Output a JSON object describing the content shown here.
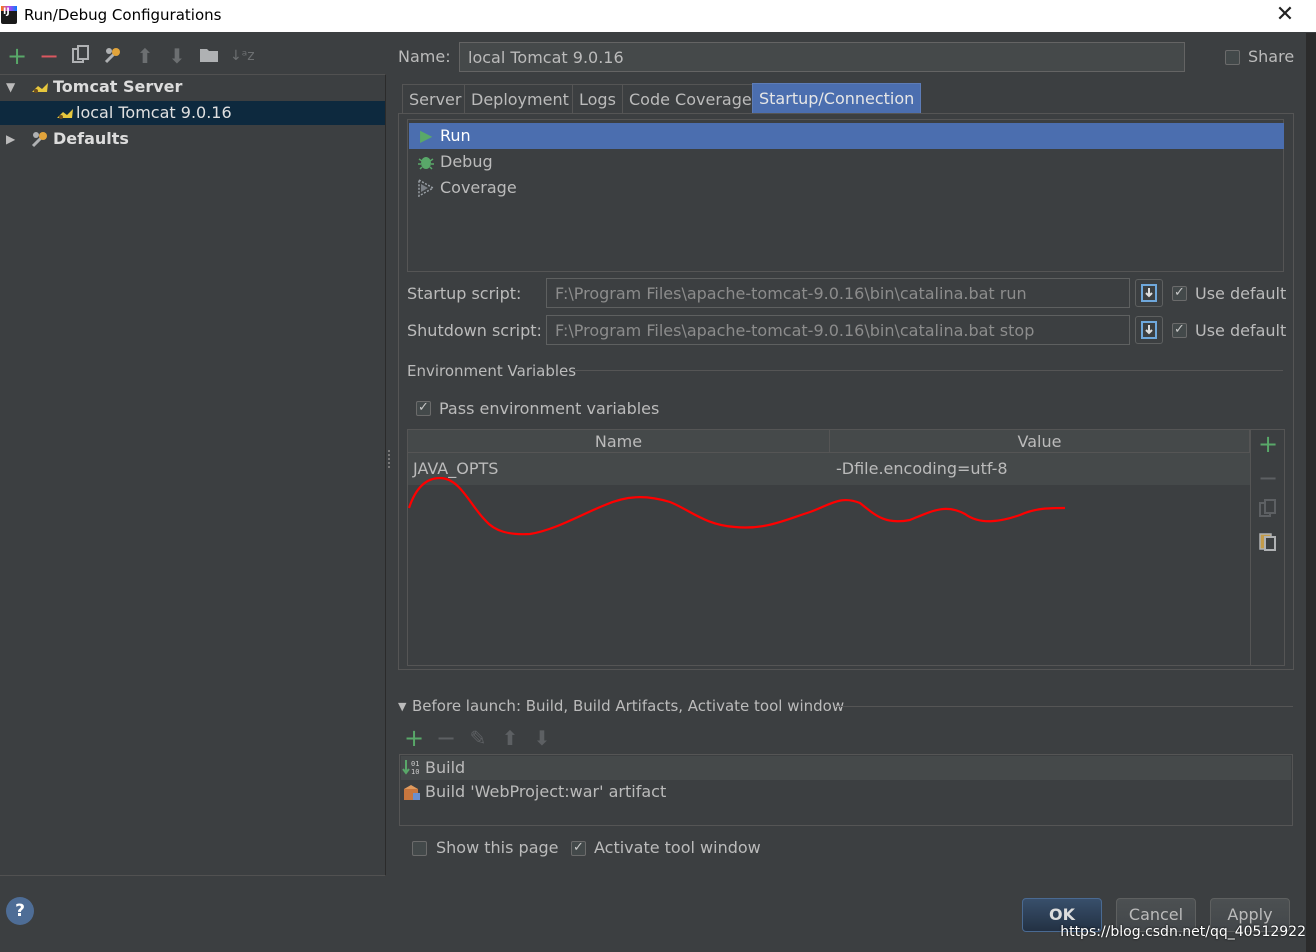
{
  "window": {
    "title": "Run/Debug Configurations"
  },
  "left_toolbar": {
    "icons": [
      "add-icon",
      "remove-icon",
      "copy-icon",
      "wrench-icon",
      "arrow-up-icon",
      "arrow-down-icon",
      "folder-icon",
      "sort-icon"
    ]
  },
  "tree": {
    "group": "Tomcat Server",
    "child": "local Tomcat 9.0.16",
    "defaults": "Defaults"
  },
  "config": {
    "name_label": "Name:",
    "name_value": "local Tomcat 9.0.16",
    "share_label": "Share"
  },
  "tabs": [
    "Server",
    "Deployment",
    "Logs",
    "Code Coverage",
    "Startup/Connection"
  ],
  "active_tab": "Startup/Connection",
  "modes": [
    "Run",
    "Debug",
    "Coverage"
  ],
  "startup": {
    "startup_label": "Startup script:",
    "startup_value": "F:\\Program Files\\apache-tomcat-9.0.16\\bin\\catalina.bat run",
    "shutdown_label": "Shutdown script:",
    "shutdown_value": "F:\\Program Files\\apache-tomcat-9.0.16\\bin\\catalina.bat stop",
    "use_default": "Use default"
  },
  "env": {
    "section_title": "Environment Variables",
    "pass_label": "Pass environment variables",
    "col_name": "Name",
    "col_value": "Value",
    "rows": [
      {
        "name": "JAVA_OPTS",
        "value": "-Dfile.encoding=utf-8"
      }
    ]
  },
  "before_launch": {
    "title": "Before launch: Build, Build Artifacts, Activate tool window",
    "items": [
      "Build",
      "Build 'WebProject:war' artifact"
    ]
  },
  "bottom": {
    "show_page": "Show this page",
    "activate_window": "Activate tool window",
    "ok": "OK",
    "cancel": "Cancel",
    "apply": "Apply",
    "help": "?"
  },
  "watermark": "https://blog.csdn.net/qq_40512922",
  "colors": {
    "accent": "#4b6eaf",
    "selected_tree": "#0d293e",
    "add_green": "#59a869",
    "remove_red": "#db5860",
    "annotation_red": "#ff0000"
  }
}
